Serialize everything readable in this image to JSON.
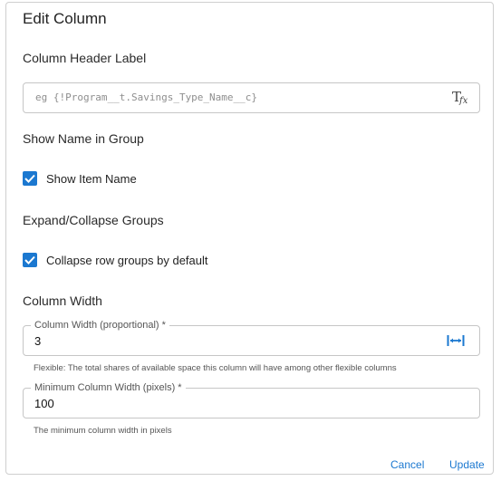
{
  "dialog": {
    "title": "Edit Column",
    "header_label_section": "Column Header Label",
    "header_label_input": {
      "value": "",
      "placeholder": "eg {!Program__t.Savings_Type_Name__c}"
    },
    "show_name_section": "Show Name in Group",
    "show_item_name": {
      "label": "Show Item Name",
      "checked": true
    },
    "expand_collapse_section": "Expand/Collapse Groups",
    "collapse_default": {
      "label": "Collapse row groups by default",
      "checked": true
    },
    "column_width_section": "Column Width",
    "proportional_width": {
      "legend": "Column Width (proportional) *",
      "value": "3",
      "helper": "Flexible: The total shares of available space this column will have among other flexible columns"
    },
    "min_width": {
      "legend": "Minimum Column Width (pixels) *",
      "value": "100",
      "helper": "The minimum column width in pixels"
    },
    "cancel_label": "Cancel",
    "update_label": "Update"
  },
  "icons": {
    "formula": "formula-fx-icon",
    "width": "horizontal-resize-icon",
    "check": "checkmark-icon"
  },
  "colors": {
    "accent": "#1b78d0",
    "border": "#c6c6c6"
  }
}
